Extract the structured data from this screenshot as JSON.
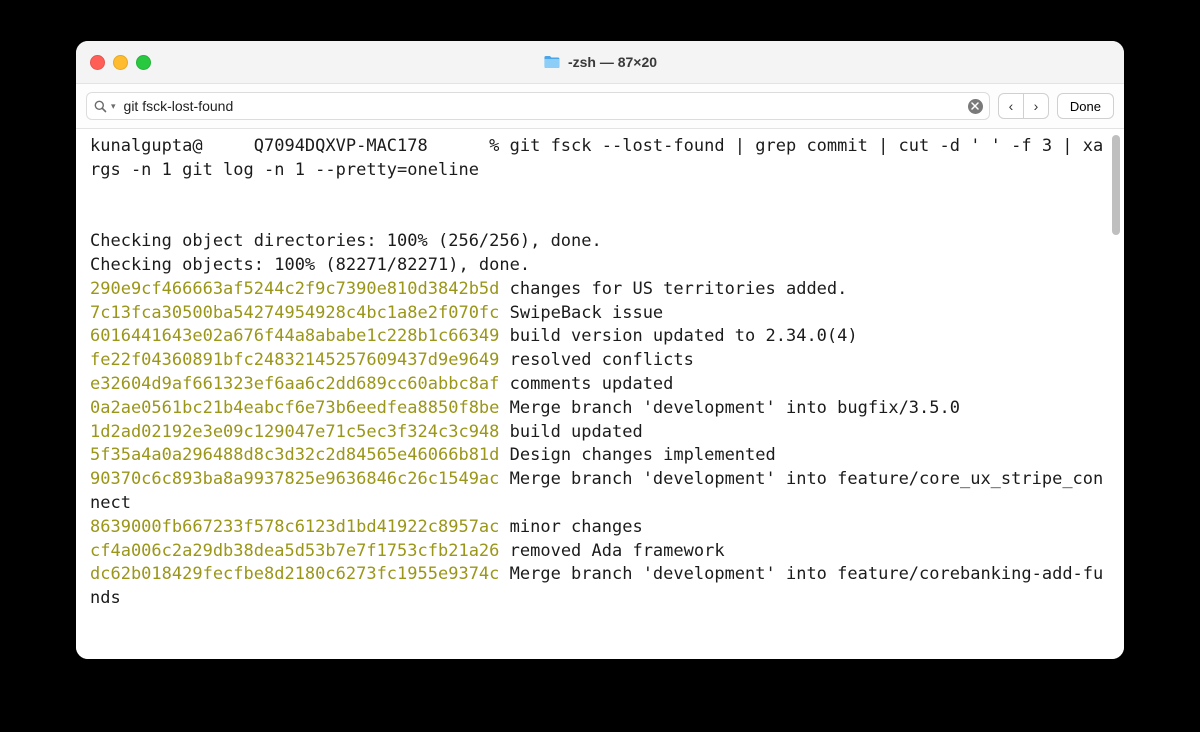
{
  "window": {
    "title": "-zsh — 87×20",
    "title_dimmed_prefix": ""
  },
  "search": {
    "query": "git fsck-lost-found"
  },
  "buttons": {
    "done": "Done"
  },
  "prompt": {
    "user": "kunalgupta",
    "host": "Q7094DQXVP-MAC178",
    "symbol": "%",
    "command": "git fsck --lost-found | grep commit | cut -d ' ' -f 3 | xargs -n 1 git log -n 1 --pretty=oneline"
  },
  "status_lines": [
    "Checking object directories: 100% (256/256), done.",
    "Checking objects: 100% (82271/82271), done."
  ],
  "commits": [
    {
      "hash": "290e9cf466663af5244c2f9c7390e810d3842b5d",
      "msg": "changes for US territories added."
    },
    {
      "hash": "7c13fca30500ba54274954928c4bc1a8e2f070fc",
      "msg": "SwipeBack issue"
    },
    {
      "hash": "6016441643e02a676f44a8ababe1c228b1c66349",
      "msg": "build version updated to 2.34.0(4)"
    },
    {
      "hash": "fe22f04360891bfc24832145257609437d9e9649",
      "msg": "resolved conflicts"
    },
    {
      "hash": "e32604d9af661323ef6aa6c2dd689cc60abbc8af",
      "msg": "comments updated"
    },
    {
      "hash": "0a2ae0561bc21b4eabcf6e73b6eedfea8850f8be",
      "msg": "Merge branch 'development' into bugfix/3.5.0"
    },
    {
      "hash": "1d2ad02192e3e09c129047e71c5ec3f324c3c948",
      "msg": "build updated"
    },
    {
      "hash": "5f35a4a0a296488d8c3d32c2d84565e46066b81d",
      "msg": "Design changes implemented"
    },
    {
      "hash": "90370c6c893ba8a9937825e9636846c26c1549ac",
      "msg": "Merge branch 'development' into feature/core_ux_stripe_connect"
    },
    {
      "hash": "8639000fb667233f578c6123d1bd41922c8957ac",
      "msg": "minor changes"
    },
    {
      "hash": "cf4a006c2a29db38dea5d53b7e7f1753cfb21a26",
      "msg": "removed Ada framework"
    },
    {
      "hash": "dc62b018429fecfbe8d2180c6273fc1955e9374c",
      "msg": "Merge branch 'development' into feature/corebanking-add-funds"
    }
  ]
}
